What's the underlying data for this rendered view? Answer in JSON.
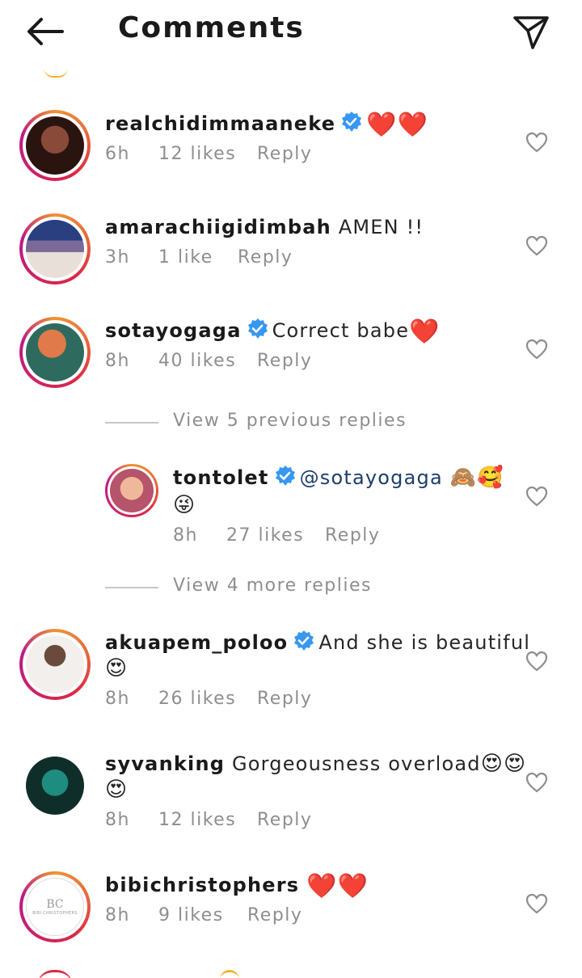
{
  "header": {
    "title": "Comments",
    "back_icon": "arrow-left-icon",
    "send_icon": "send-icon"
  },
  "comments": [
    {
      "username": "realchidimmaaneke",
      "verified": true,
      "text": "",
      "emojis": "❤️❤️",
      "time": "6h",
      "likes": "12 likes",
      "reply": "Reply",
      "avatar_colors": [
        "#6b3b2e",
        "#1a1a1a"
      ]
    },
    {
      "username": "amarachiigidimbah",
      "verified": false,
      "text": "AMEN !!",
      "emojis": "",
      "time": "3h",
      "likes": "1 like",
      "reply": "Reply",
      "avatar_colors": [
        "#2c3e77",
        "#d8d0c8"
      ]
    },
    {
      "username": "sotayogaga",
      "verified": true,
      "text": "Correct babe",
      "emojis": "❤️",
      "time": "8h",
      "likes": "40 likes",
      "reply": "Reply",
      "avatar_colors": [
        "#c94f2a",
        "#2e6b5e"
      ]
    },
    {
      "username": "akuapem_poloo",
      "verified": true,
      "text": "And she is beautiful",
      "emojis": "😍",
      "time": "8h",
      "likes": "26 likes",
      "reply": "Reply",
      "avatar_colors": [
        "#e8e4e2",
        "#6a4a3a"
      ]
    },
    {
      "username": "syvanking",
      "verified": false,
      "text": "Gorgeousness overload",
      "emojis": "😍😍",
      "emojis_line2": "😍",
      "time": "8h",
      "likes": "12 likes",
      "reply": "Reply",
      "avatar_colors": [
        "#0f2e2a",
        "#1e8c7e"
      ]
    },
    {
      "username": "bibichristophers",
      "verified": false,
      "text": "",
      "emojis": "❤️❤️",
      "time": "8h",
      "likes": "9 likes",
      "reply": "Reply",
      "avatar_colors": [
        "#ffffff",
        "#9a9a9a"
      ],
      "avatar_text": "BC",
      "avatar_subtext": "BIBI CHRISTOPHERS"
    }
  ],
  "threads": {
    "previous_replies": "View 5 previous replies",
    "more_replies": "View 4 more replies"
  },
  "reply": {
    "username": "tontolet",
    "verified": true,
    "mention": "@sotayogaga",
    "emojis": "🙈🥰",
    "emojis_line2": "😜",
    "time": "8h",
    "likes": "27 likes",
    "reply": "Reply",
    "avatar_colors": [
      "#e8a07a",
      "#b5546a"
    ]
  },
  "colors": {
    "verified_blue": "#3897f0",
    "heart_red": "#e0102a",
    "meta_gray": "#8e8e8e"
  }
}
